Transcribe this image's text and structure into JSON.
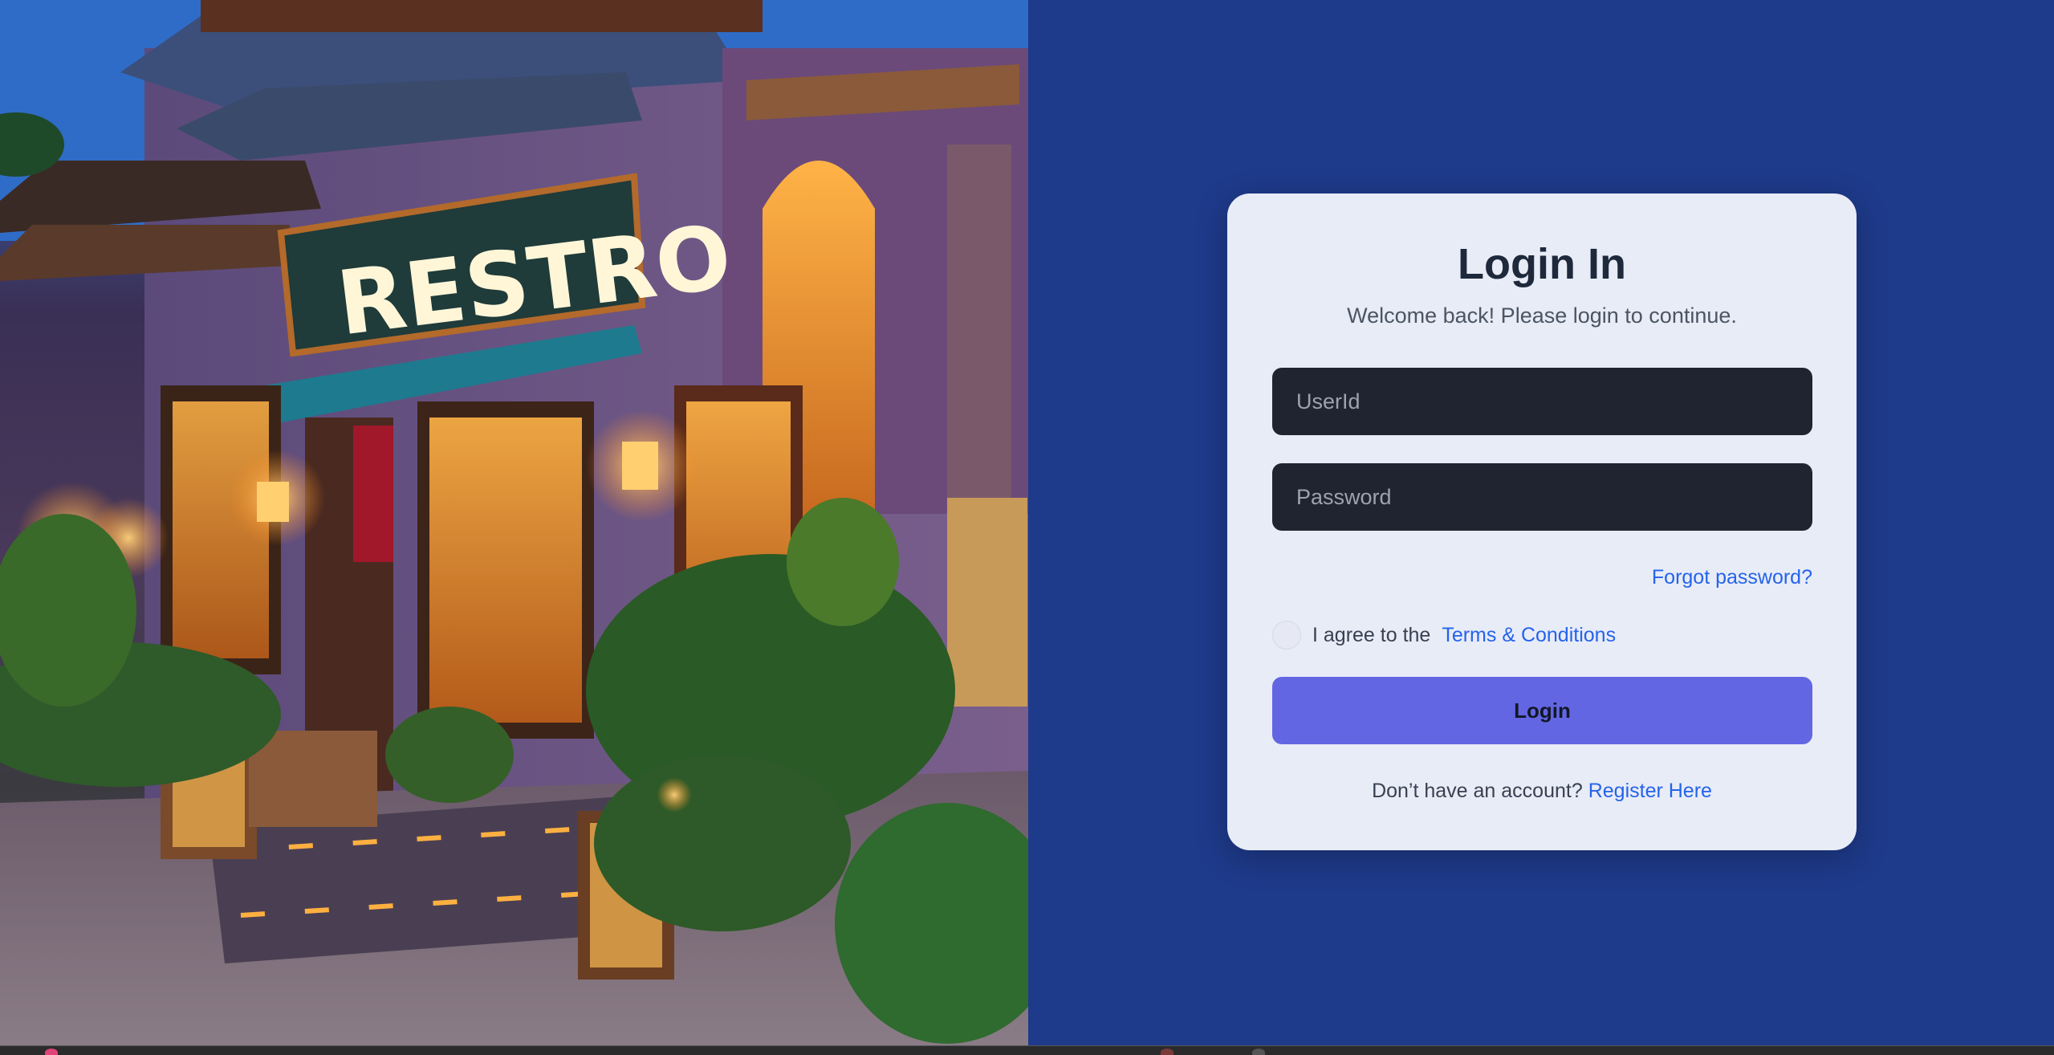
{
  "hero": {
    "image_alt": "Restaurant storefront at dusk with a glowing RESTRO sign",
    "sign_text": "RESTRO"
  },
  "login": {
    "title": "Login In",
    "subtitle": "Welcome back! Please login to continue.",
    "userid_placeholder": "UserId",
    "password_placeholder": "Password",
    "forgot_password": "Forgot password?",
    "agree_text": "I agree to the",
    "terms_link": "Terms & Conditions",
    "login_button": "Login",
    "register_prompt": "Don’t have an account?",
    "register_link": "Register Here"
  },
  "colors": {
    "background": "#1e3a8a",
    "card": "#e8ecf7",
    "input": "#1f2430",
    "button": "#6366e3",
    "link": "#2563eb"
  }
}
